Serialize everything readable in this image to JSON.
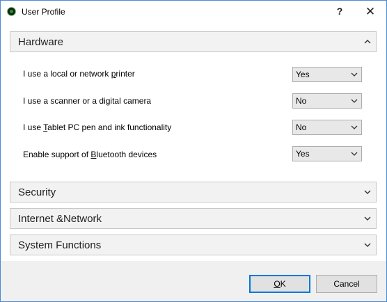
{
  "window": {
    "title": "User Profile",
    "help_label": "?",
    "close_label": "✕"
  },
  "sections": {
    "hardware": {
      "title": "Hardware",
      "expanded": true,
      "rows": [
        {
          "label_pre": "I use a local or network ",
          "label_key": "p",
          "label_post": "rinter",
          "value": "Yes"
        },
        {
          "label_pre": "I use a scanner or a di",
          "label_key": "g",
          "label_post": "ital camera",
          "value": "No"
        },
        {
          "label_pre": "I use ",
          "label_key": "T",
          "label_post": "ablet PC pen and ink functionality",
          "value": "No"
        },
        {
          "label_pre": "Enable support of ",
          "label_key": "B",
          "label_post": "luetooth devices",
          "value": "Yes"
        }
      ]
    },
    "security": {
      "title": "Security",
      "expanded": false
    },
    "internet": {
      "title": "Internet &Network",
      "expanded": false
    },
    "system": {
      "title": "System Functions",
      "expanded": false
    }
  },
  "buttons": {
    "ok_key": "O",
    "ok_rest": "K",
    "cancel_label": "Cancel"
  },
  "icons": {
    "app": "app-globe-icon",
    "chevron_up": "chevron-up-icon",
    "chevron_down": "chevron-down-icon"
  },
  "colors": {
    "focus_border": "#0078d7",
    "panel_bg": "#f2f2f2",
    "footer_bg": "#f0f0f0"
  }
}
